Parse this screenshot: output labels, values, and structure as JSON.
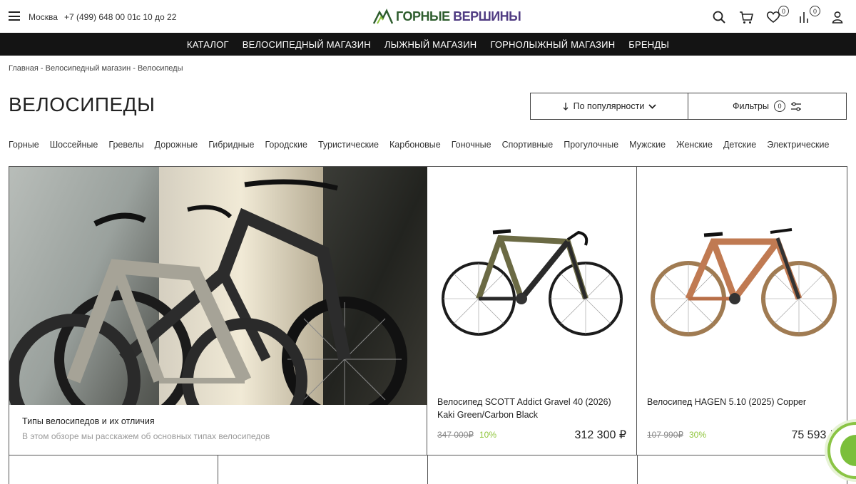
{
  "header": {
    "city": "Москва",
    "phone": "+7 (499) 648 00 01",
    "hours": "с 10 до 22",
    "logo_text_a": "ГОРНЫЕ",
    "logo_text_b": "ВЕРШИНЫ",
    "favorites_count": "0",
    "compare_count": "0"
  },
  "nav": {
    "items": [
      "КАТАЛОГ",
      "ВЕЛОСИПЕДНЫЙ МАГАЗИН",
      "ЛЫЖНЫЙ МАГАЗИН",
      "ГОРНОЛЫЖНЫЙ МАГАЗИН",
      "БРЕНДЫ"
    ]
  },
  "breadcrumb": {
    "text": "Главная - Велосипедный магазин - Велосипеды"
  },
  "page": {
    "title": "ВЕЛОСИПЕДЫ",
    "sort_label": "По популярности",
    "filters_label": "Фильтры",
    "filters_count": "0"
  },
  "types": [
    "Горные",
    "Шоссейные",
    "Гревелы",
    "Дорожные",
    "Гибридные",
    "Городские",
    "Туристические",
    "Карбоновые",
    "Гоночные",
    "Спортивные",
    "Прогулочные",
    "Мужские",
    "Женские",
    "Детские",
    "Электрические"
  ],
  "article": {
    "title": "Типы велосипедов и их отличия",
    "subtitle": "В этом обзоре мы расскажем об основных типах велосипедов"
  },
  "products": [
    {
      "name": "Велосипед SCOTT Addict Gravel 40 (2026) Kaki Green/Carbon Black",
      "old_price": "347 000₽",
      "discount": "10%",
      "price": "312 300 ₽",
      "frame_color": "#6b6a44"
    },
    {
      "name": "Велосипед HAGEN 5.10 (2025) Copper",
      "old_price": "107 990₽",
      "discount": "30%",
      "price": "75 593 ₽",
      "frame_color": "#c07a52"
    }
  ],
  "colors": {
    "navbar": "#141414",
    "discount": "#8fc53b",
    "logo_green": "#2e5d2e",
    "logo_purple": "#4f3b82"
  }
}
